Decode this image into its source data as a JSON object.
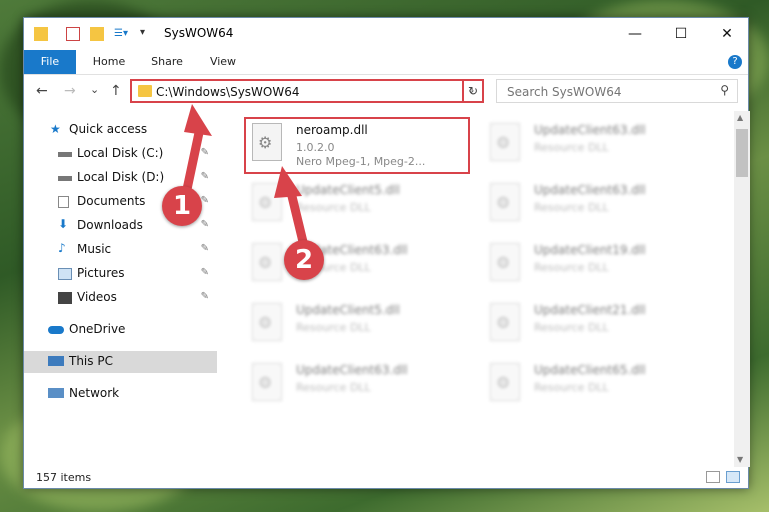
{
  "window": {
    "title": "SysWOW64",
    "minimize": "—",
    "maximize": "☐",
    "close": "✕",
    "help": "?"
  },
  "ribbon": {
    "tabs": [
      "File",
      "Home",
      "Share",
      "View"
    ]
  },
  "address": {
    "path": "C:\\Windows\\SysWOW64",
    "dropdown": "⌄",
    "refresh": "↻"
  },
  "nav_buttons": {
    "back": "←",
    "forward": "→",
    "recent": "⌄",
    "up": "↑"
  },
  "search": {
    "placeholder": "Search SysWOW64",
    "icon": "⚲"
  },
  "sidebar": {
    "items": [
      {
        "label": "Quick access",
        "icon": "star-icon",
        "pinned": false
      },
      {
        "label": "Local Disk (C:)",
        "icon": "drive-icon",
        "pinned": true
      },
      {
        "label": "Local Disk (D:)",
        "icon": "drive-icon",
        "pinned": true
      },
      {
        "label": "Documents",
        "icon": "documents-icon",
        "pinned": true
      },
      {
        "label": "Downloads",
        "icon": "downloads-icon",
        "pinned": true
      },
      {
        "label": "Music",
        "icon": "music-icon",
        "pinned": true
      },
      {
        "label": "Pictures",
        "icon": "pictures-icon",
        "pinned": true
      },
      {
        "label": "Videos",
        "icon": "videos-icon",
        "pinned": true
      },
      {
        "label": "OneDrive",
        "icon": "cloud-icon",
        "pinned": false
      },
      {
        "label": "This PC",
        "icon": "computer-icon",
        "pinned": false
      },
      {
        "label": "Network",
        "icon": "network-icon",
        "pinned": false
      }
    ],
    "pin_glyph": "📌"
  },
  "files": [
    {
      "name": "neroamp.dll",
      "version": "1.0.2.0",
      "desc": "Nero Mpeg-1, Mpeg-2...",
      "blurred": false
    },
    {
      "name": "UpdateClient63.dll",
      "desc": "Resource DLL",
      "blurred": true
    },
    {
      "name": "UpdateClient5.dll",
      "desc": "Resource DLL",
      "blurred": true
    },
    {
      "name": "UpdateClient63.dll",
      "desc": "Resource DLL",
      "blurred": true
    },
    {
      "name": "UpdateClient63.dll",
      "desc": "Resource DLL",
      "blurred": true
    },
    {
      "name": "UpdateClient19.dll",
      "desc": "Resource DLL",
      "blurred": true
    },
    {
      "name": "UpdateClient5.dll",
      "desc": "Resource DLL",
      "blurred": true
    },
    {
      "name": "UpdateClient21.dll",
      "desc": "Resource DLL",
      "blurred": true
    },
    {
      "name": "UpdateClient63.dll",
      "desc": "Resource DLL",
      "blurred": true
    },
    {
      "name": "UpdateClient65.dll",
      "desc": "Resource DLL",
      "blurred": true
    }
  ],
  "status": {
    "count": "157 items"
  },
  "annotations": {
    "step1": "1",
    "step2": "2"
  },
  "colors": {
    "accent": "#1979ca",
    "highlight": "#d8434a"
  }
}
